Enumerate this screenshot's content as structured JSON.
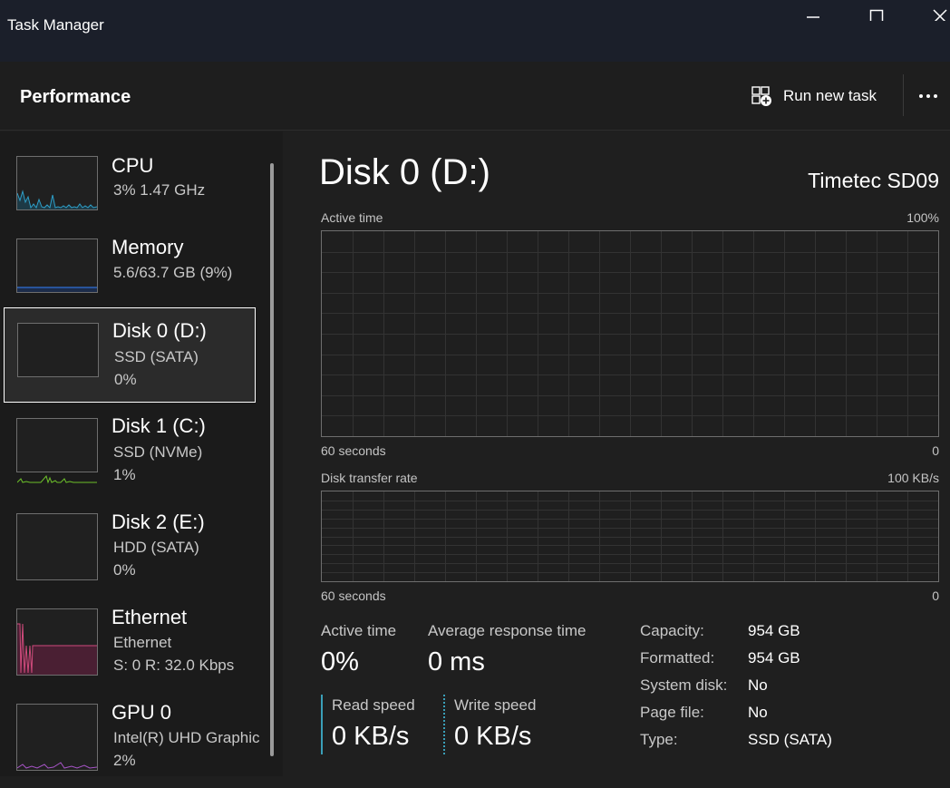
{
  "window": {
    "title": "Task Manager",
    "controls": [
      "minimize-icon",
      "maximize-icon",
      "close-icon"
    ]
  },
  "header": {
    "title": "Performance",
    "run_task_label": "Run new task",
    "run_task_icon": "run-task-icon",
    "more_icon": "more-options-icon"
  },
  "sidebar": {
    "items": [
      {
        "name": "CPU",
        "line1": "3%  1.47 GHz",
        "line2": "",
        "color": "#2e9ec7",
        "selected": false
      },
      {
        "name": "Memory",
        "line1": "5.6/63.7 GB (9%)",
        "line2": "",
        "color": "#2f6fd6",
        "selected": false
      },
      {
        "name": "Disk 0 (D:)",
        "line1": "SSD (SATA)",
        "line2": "0%",
        "color": "#6cbf2a",
        "selected": true
      },
      {
        "name": "Disk 1 (C:)",
        "line1": "SSD (NVMe)",
        "line2": "1%",
        "color": "#6cbf2a",
        "selected": false
      },
      {
        "name": "Disk 2 (E:)",
        "line1": "HDD (SATA)",
        "line2": "0%",
        "color": "#6cbf2a",
        "selected": false
      },
      {
        "name": "Ethernet",
        "line1": "Ethernet",
        "line2": "S: 0  R: 32.0 Kbps",
        "color": "#d04a7c",
        "selected": false
      },
      {
        "name": "GPU 0",
        "line1": "Intel(R) UHD Graphic",
        "line2": "2%",
        "color": "#a855c8",
        "selected": false
      }
    ]
  },
  "main": {
    "title": "Disk 0 (D:)",
    "model": "Timetec SD09",
    "active_graph": {
      "label": "Active time",
      "max": "100%",
      "time_span": "60 seconds",
      "min": "0"
    },
    "transfer_graph": {
      "label": "Disk transfer rate",
      "max": "100 KB/s",
      "time_span": "60 seconds",
      "min": "0"
    },
    "stats": {
      "active_time_label": "Active time",
      "active_time_value": "0%",
      "response_label": "Average response time",
      "response_value": "0 ms",
      "read_label": "Read speed",
      "read_value": "0 KB/s",
      "write_label": "Write speed",
      "write_value": "0 KB/s"
    },
    "properties": [
      {
        "key": "Capacity:",
        "value": "954 GB"
      },
      {
        "key": "Formatted:",
        "value": "954 GB"
      },
      {
        "key": "System disk:",
        "value": "No"
      },
      {
        "key": "Page file:",
        "value": "No"
      },
      {
        "key": "Type:",
        "value": "SSD (SATA)"
      }
    ]
  }
}
